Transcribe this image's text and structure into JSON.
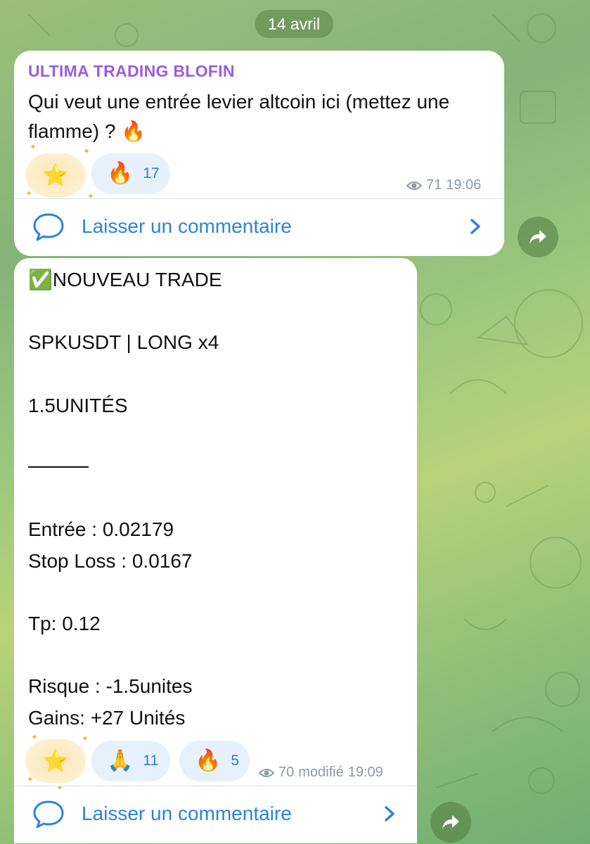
{
  "chat": {
    "date": "14 avril"
  },
  "message1": {
    "sender": "ULTIMA TRADING BLOFIN",
    "text": "Qui veut une entrée levier altcoin ici (mettez une flamme) ? 🔥",
    "reactions": [
      {
        "emoji": "⭐",
        "label": "star-effect"
      },
      {
        "emoji": "🔥",
        "count": "17"
      }
    ],
    "views": "71",
    "time": "19:06",
    "comment_label": "Laisser un commentaire"
  },
  "message2": {
    "lines": [
      "✅NOUVEAU TRADE",
      "SPKUSDT | LONG x4",
      "1.5UNITÉS",
      "Entrée : 0.02179",
      "Stop Loss : 0.0167",
      "Tp: 0.12",
      "Risque : -1.5unites",
      "Gains: +27 Unités"
    ],
    "reactions": [
      {
        "emoji": "⭐",
        "label": "star-effect"
      },
      {
        "emoji": "🙏",
        "count": "11"
      },
      {
        "emoji": "🔥",
        "count": "5"
      }
    ],
    "views": "70",
    "edited": "modifié",
    "time": "19:09",
    "comment_label": "Laisser un commentaire"
  },
  "icons": {
    "eye": "eye-icon",
    "comment": "speech-bubble-icon",
    "chevron": "chevron-right-icon",
    "share": "share-arrow-icon"
  },
  "colors": {
    "sender": "#9b5de0",
    "link": "#2b84d8",
    "reaction_bg": "#e7f1fc",
    "meta": "#8e9aa3"
  }
}
